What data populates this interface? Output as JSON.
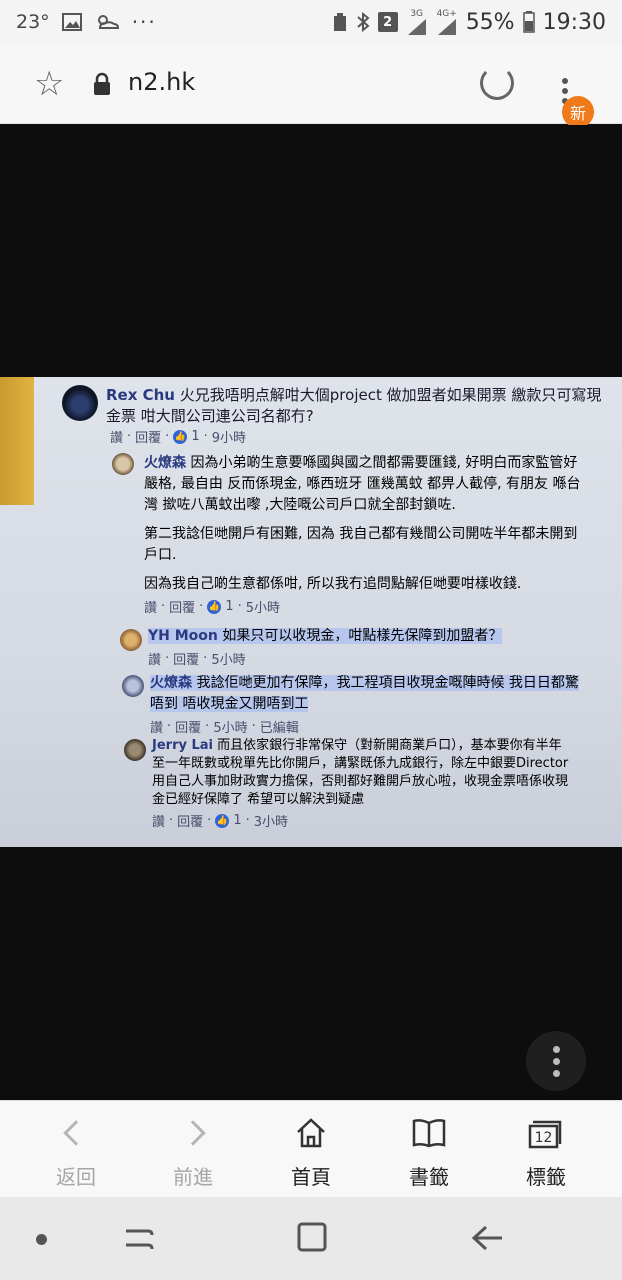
{
  "status_bar": {
    "temperature": "23°",
    "more": "···",
    "sim_badge": "2",
    "network_3g": "3G",
    "network_4g": "4G+",
    "battery": "55%",
    "time": "19:30"
  },
  "address_bar": {
    "url": "n2.hk",
    "new_badge": "新"
  },
  "post": {
    "author": "Rex Chu",
    "text": "火兄我唔明点解咁大個project 做加盟者如果開票 繳款只可寫現金票 咁大間公司連公司名都冇?",
    "meta": {
      "read": "讚",
      "reply": "回覆",
      "likes": "1",
      "time": "9小時"
    },
    "comments": [
      {
        "author": "火燎森",
        "paragraphs": [
          "因為小弟啲生意要喺國與國之間都需要匯錢, 好明白而家監管好嚴格, 最自由 反而係現金, 喺西班牙 匯幾萬蚊 都畀人截停, 有朋友 喺台灣 撳咗八萬蚊出嚟 ,大陸嘅公司戶口就全部封鎖咗.",
          "第二我諗佢哋開戶有困難, 因為 我自己都有幾間公司開咗半年都未開到戶口.",
          "因為我自己啲生意都係咁, 所以我冇追問點解佢哋要咁樣收錢."
        ],
        "meta": {
          "read": "讚",
          "reply": "回覆",
          "likes": "1",
          "time": "5小時"
        }
      },
      {
        "author": "YH Moon",
        "text": "如果只可以收現金，咁點樣先保障到加盟者？",
        "meta": {
          "read": "讚",
          "reply": "回覆",
          "time": "5小時"
        }
      },
      {
        "author": "火燎森",
        "text": "我諗佢哋更加冇保障，我工程項目收現金嘅陣時候 我日日都驚唔到 唔收現金又開唔到工",
        "meta": {
          "read": "讚",
          "reply": "回覆",
          "time": "5小時",
          "edited": "已編輯"
        }
      },
      {
        "author": "Jerry Lai",
        "text": "而且依家銀行非常保守（對新開商業戶口），基本要你有半年至一年既數或稅單先比你開戶，講緊既係九成銀行，除左中銀要Director用自己人事加財政實力擔保，否則都好難開戶放心啦，收現金票唔係收現金已經好保障了 希望可以解決到疑慮",
        "meta": {
          "read": "讚",
          "reply": "回覆",
          "likes": "1",
          "time": "3小時"
        }
      }
    ]
  },
  "toolbar": {
    "back": "返回",
    "forward": "前進",
    "home": "首頁",
    "bookmarks": "書籤",
    "tabs": "標籤",
    "tab_count": "12"
  }
}
